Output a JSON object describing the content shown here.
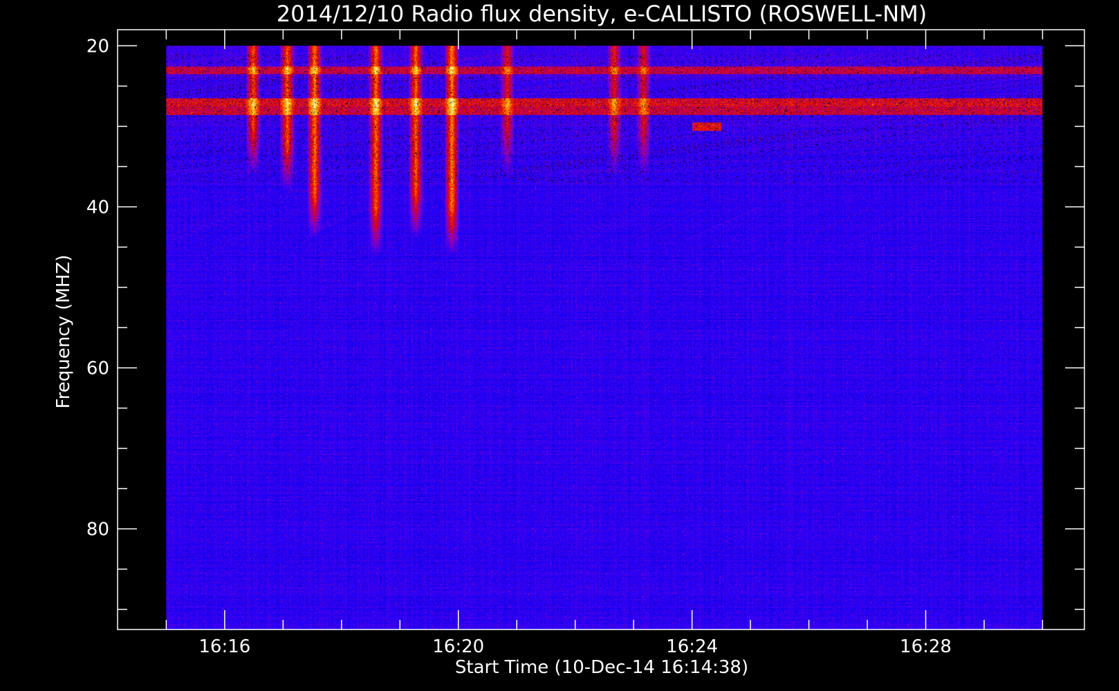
{
  "chart_data": {
    "type": "heatmap",
    "title": "2014/12/10  Radio flux density, e-CALLISTO (ROSWELL-NM)",
    "xlabel": "Start Time (10-Dec-14 16:14:38)",
    "ylabel": "Frequency (MHZ)",
    "x_unit": "minutes",
    "xlim": [
      "16:14:10",
      "16:30:43"
    ],
    "ylim": [
      92.5,
      18
    ],
    "data_extent": {
      "x": [
        "16:15:00",
        "16:30:00"
      ],
      "y": [
        20,
        92.5
      ]
    },
    "xticks": [
      "16:16",
      "16:20",
      "16:24",
      "16:28"
    ],
    "xminor_step_minutes": 1,
    "yticks": [
      20,
      40,
      60,
      80
    ],
    "yminor_step": 5,
    "colormap": [
      "#000000",
      "#1800ff",
      "#8800c8",
      "#e00000",
      "#ff6000",
      "#ffd000",
      "#ffffd0"
    ],
    "background_level": "#1f10f0",
    "bursts": [
      {
        "time": "16:16:29",
        "f_low": 20,
        "f_high": 36,
        "intensity": 0.8
      },
      {
        "time": "16:17:04",
        "f_low": 20,
        "f_high": 38,
        "intensity": 0.85
      },
      {
        "time": "16:17:32",
        "f_low": 20,
        "f_high": 44,
        "intensity": 0.95
      },
      {
        "time": "16:18:35",
        "f_low": 20,
        "f_high": 46,
        "intensity": 0.9
      },
      {
        "time": "16:19:16",
        "f_low": 20,
        "f_high": 44,
        "intensity": 0.9
      },
      {
        "time": "16:19:53",
        "f_low": 20,
        "f_high": 46,
        "intensity": 1.0
      },
      {
        "time": "16:20:50",
        "f_low": 20,
        "f_high": 36,
        "intensity": 0.6
      },
      {
        "time": "16:22:40",
        "f_low": 20,
        "f_high": 36,
        "intensity": 0.6
      },
      {
        "time": "16:23:10",
        "f_low": 20,
        "f_high": 36,
        "intensity": 0.55
      }
    ],
    "bands": [
      {
        "freq": 23,
        "t_start": "16:15:00",
        "t_end": "16:30:00",
        "intensity": 0.55
      },
      {
        "freq": 27,
        "t_start": "16:15:00",
        "t_end": "16:30:00",
        "intensity": 0.7
      },
      {
        "freq": 28,
        "t_start": "16:15:00",
        "t_end": "16:30:00",
        "intensity": 0.6
      },
      {
        "freq": 30,
        "t_start": "16:24:00",
        "t_end": "16:24:30",
        "intensity": 0.75
      }
    ]
  }
}
